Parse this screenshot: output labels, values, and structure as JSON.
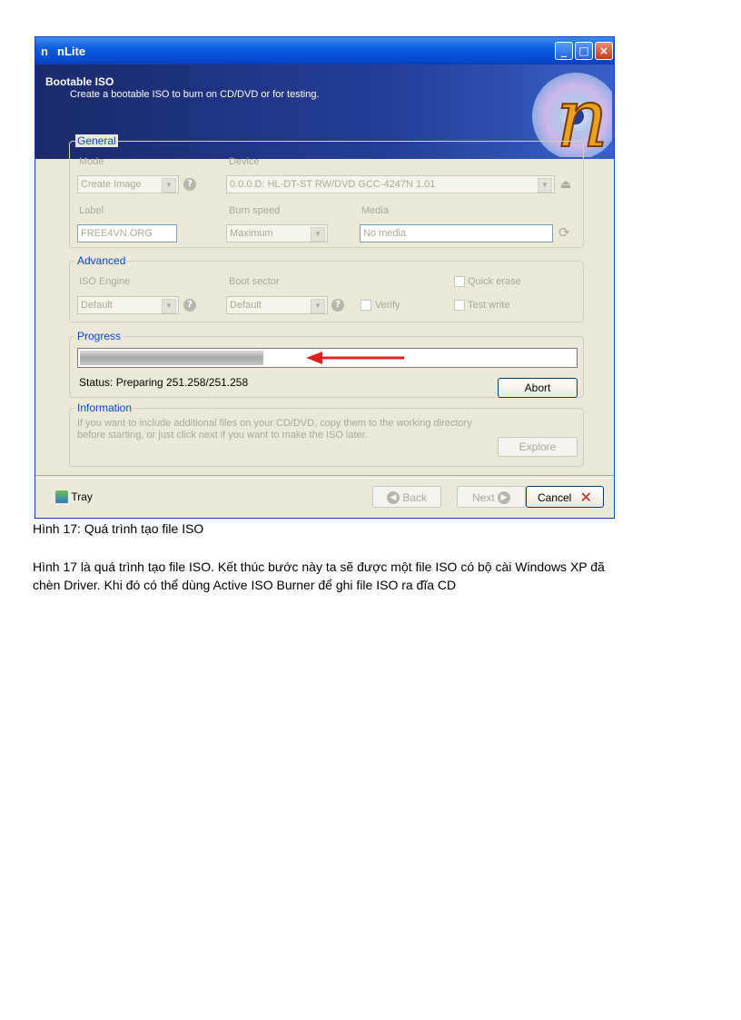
{
  "window": {
    "app_logo": "n",
    "title": "nLite",
    "buttons": {
      "minimize": "_",
      "maximize": "□",
      "close": "×"
    }
  },
  "banner": {
    "title": "Bootable ISO",
    "subtitle": "Create a bootable ISO to burn on CD/DVD or for testing.",
    "logo_glyph": "n"
  },
  "general": {
    "legend": "General",
    "mode_label": "Mode",
    "mode_value": "Create Image",
    "device_label": "Device",
    "device_value": "0.0.0.D: HL-DT-ST RW/DVD GCC-4247N 1.01",
    "label_label": "Label",
    "label_value": "FREE4VN.ORG",
    "burn_speed_label": "Burn speed",
    "burn_speed_value": "Maximum",
    "media_label": "Media",
    "media_value": "No media"
  },
  "advanced": {
    "legend": "Advanced",
    "iso_engine_label": "ISO Engine",
    "iso_engine_value": "Default",
    "boot_sector_label": "Boot sector",
    "boot_sector_value": "Default",
    "verify_label": "Verify",
    "quick_erase_label": "Quick erase",
    "test_write_label": "Test write"
  },
  "progress": {
    "legend": "Progress",
    "fraction": 0.37,
    "status": "Status: Preparing 251.258/251.258",
    "abort_label": "Abort"
  },
  "information": {
    "legend": "Information",
    "text_line1": "If you want to include additional files on your CD/DVD, copy them to the working directory",
    "text_line2": "before starting, or just click next if you want to make the ISO later.",
    "explore_label": "Explore"
  },
  "footer": {
    "tray_label": "Tray",
    "back_label": "Back",
    "next_label": "Next",
    "cancel_label": "Cancel"
  },
  "doc": {
    "caption": "Hình 17: Quá trình tạo file ISO",
    "paragraph_line1": "Hình 17 là quá trình tạo file ISO. Kết thúc bước này ta sẽ được một file ISO có bộ cài Windows XP đã",
    "paragraph_line2": "chèn Driver. Khi đó có thể dùng Active ISO Burner để ghi file ISO ra đĩa CD"
  },
  "colors": {
    "arrow": "#e02020",
    "accent": "#0046d5"
  }
}
